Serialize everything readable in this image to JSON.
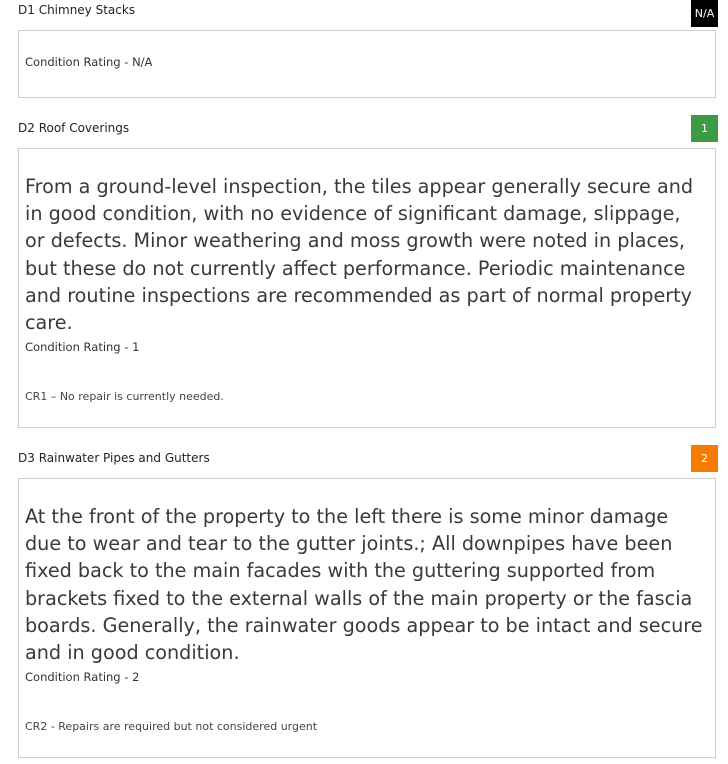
{
  "colors": {
    "badge_na": "#000000",
    "badge_1": "#3d9b46",
    "badge_2": "#f57c00"
  },
  "sections": [
    {
      "title": "D1 Chimney Stacks",
      "badge": "N/A",
      "rating_label": "Condition Rating - N/A"
    },
    {
      "title": "D2 Roof Coverings",
      "badge": "1",
      "body": "From a ground-level inspection, the tiles appear generally secure and in good condition, with no evidence of significant damage, slippage, or defects. Minor weathering and moss growth were noted in places, but these do not currently affect performance. Periodic maintenance and routine inspections are recommended as part of normal property care.",
      "rating_label": "Condition Rating - 1",
      "note": "CR1 – No repair is currently needed."
    },
    {
      "title": "D3 Rainwater Pipes and Gutters",
      "badge": "2",
      "body": "At the front of the property to the left there is some minor damage due to wear and tear to the gutter joints.; All downpipes have been fixed back to the main facades with the guttering supported from brackets fixed to the external walls of the main property or the fascia boards. Generally, the rainwater goods appear to be intact and secure and in good condition.",
      "rating_label": "Condition Rating - 2",
      "note": "CR2 - Repairs are required but not considered urgent"
    }
  ]
}
